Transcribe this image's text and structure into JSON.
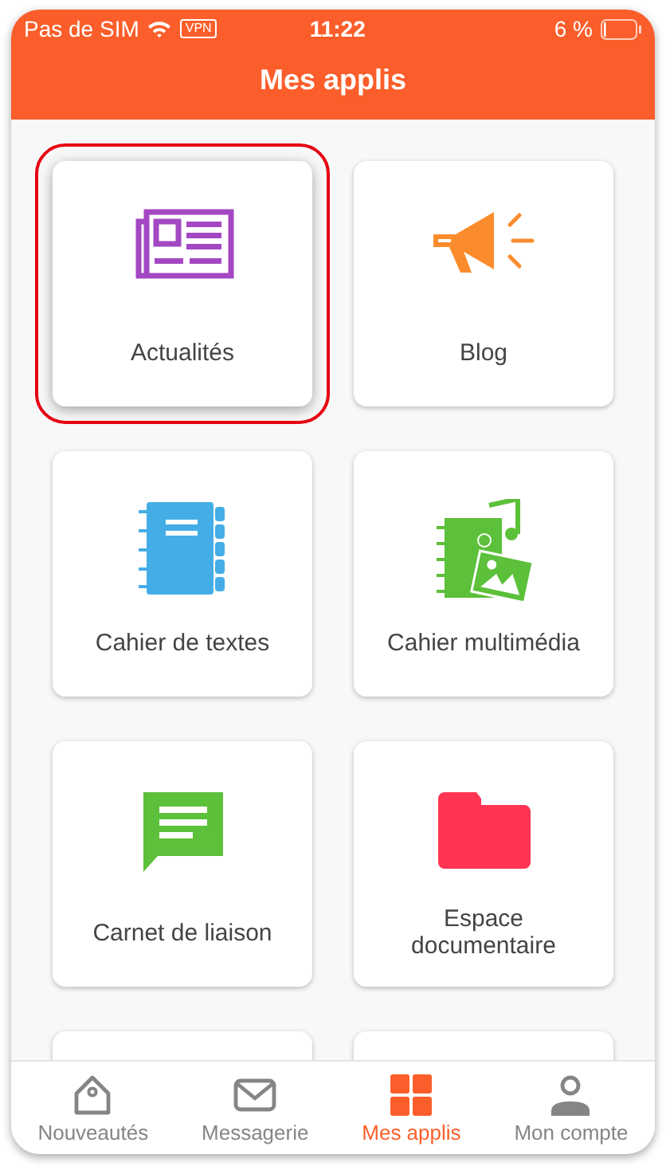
{
  "status_bar": {
    "carrier": "Pas de SIM",
    "vpn": "VPN",
    "time": "11:22",
    "battery": "6 %"
  },
  "header": {
    "title": "Mes applis"
  },
  "apps": [
    {
      "label": "Actualités",
      "kind": "news",
      "highlighted": true
    },
    {
      "label": "Blog",
      "kind": "megaphone",
      "highlighted": false
    },
    {
      "label": "Cahier de textes",
      "kind": "notebook",
      "highlighted": false
    },
    {
      "label": "Cahier multimédia",
      "kind": "media",
      "highlighted": false
    },
    {
      "label": "Carnet de liaison",
      "kind": "chat",
      "highlighted": false
    },
    {
      "label": "Espace documentaire",
      "kind": "folder",
      "highlighted": false
    },
    {
      "kind": "blank",
      "highlighted": false
    },
    {
      "kind": "blank",
      "highlighted": false
    }
  ],
  "tab_bar": [
    {
      "label": "Nouveautés",
      "kind": "home",
      "selected": false
    },
    {
      "label": "Messagerie",
      "kind": "mail",
      "selected": false
    },
    {
      "label": "Mes applis",
      "kind": "grid",
      "selected": true
    },
    {
      "label": "Mon compte",
      "kind": "user",
      "selected": false
    }
  ]
}
